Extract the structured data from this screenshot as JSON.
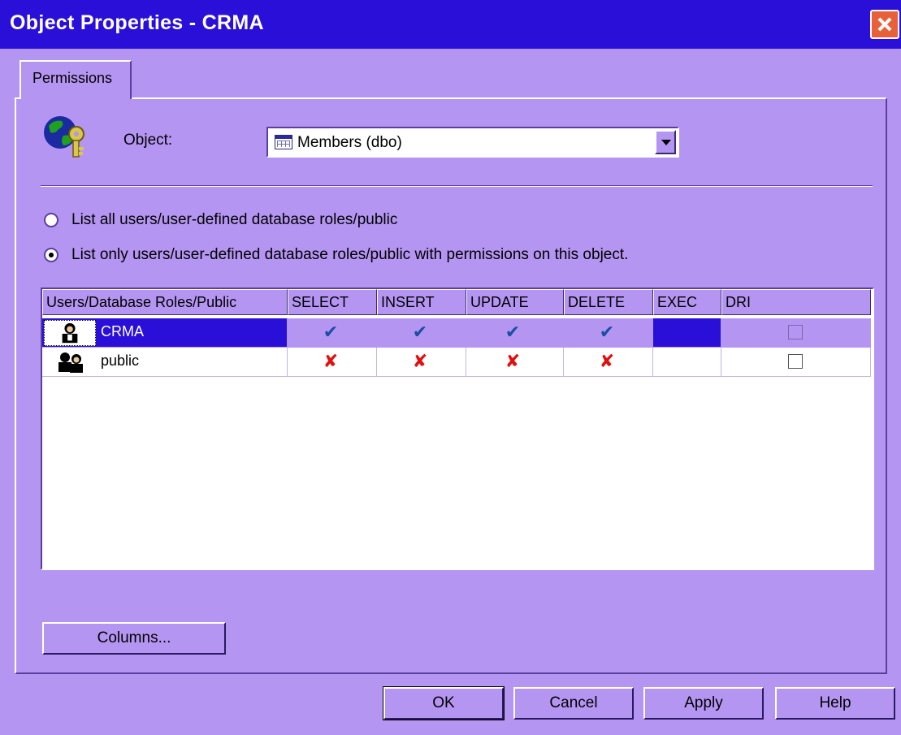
{
  "window": {
    "title": "Object Properties - CRMA"
  },
  "tabs": [
    {
      "label": "Permissions"
    }
  ],
  "object": {
    "label": "Object:",
    "value": "Members (dbo)"
  },
  "options": [
    {
      "label": "List all users/user-defined database roles/public",
      "checked": false
    },
    {
      "label": "List only users/user-defined database roles/public with permissions on this object.",
      "checked": true
    }
  ],
  "grid": {
    "columns": [
      "Users/Database Roles/Public",
      "SELECT",
      "INSERT",
      "UPDATE",
      "DELETE",
      "EXEC",
      "DRI"
    ],
    "rows": [
      {
        "name": "CRMA",
        "icon": "user-icon",
        "selected": true,
        "perms": [
          "granted",
          "granted",
          "granted",
          "granted",
          "none",
          "empty"
        ]
      },
      {
        "name": "public",
        "icon": "group-icon",
        "selected": false,
        "perms": [
          "denied",
          "denied",
          "denied",
          "denied",
          "none",
          "empty"
        ]
      }
    ]
  },
  "buttons": {
    "columns": "Columns...",
    "ok": "OK",
    "cancel": "Cancel",
    "apply": "Apply",
    "help": "Help"
  },
  "colors": {
    "titlebar": "#2a0fd8",
    "background": "#b595f2",
    "selection": "#2a0fd8",
    "granted": "#1b4fa0",
    "denied": "#e01010"
  }
}
